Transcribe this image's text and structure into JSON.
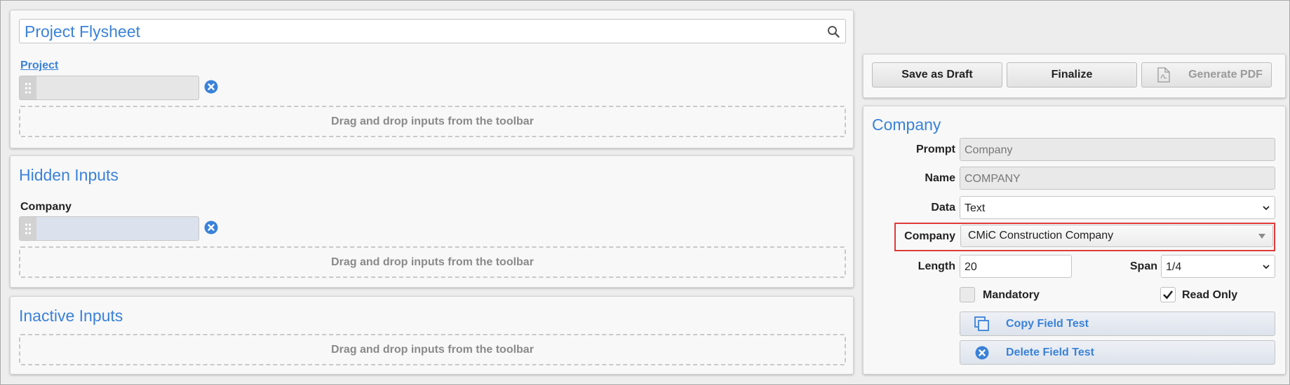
{
  "form": {
    "title": "Project Flysheet",
    "project_label": "Project",
    "dropzone_hint": "Drag and drop inputs from the toolbar"
  },
  "hidden_inputs": {
    "heading": "Hidden Inputs",
    "company_label": "Company",
    "dropzone_hint": "Drag and drop inputs from the toolbar"
  },
  "inactive_inputs": {
    "heading": "Inactive Inputs",
    "dropzone_hint": "Drag and drop inputs from the toolbar"
  },
  "toolbar": {
    "save_draft_label": "Save as Draft",
    "finalize_label": "Finalize",
    "generate_pdf_label": "Generate PDF"
  },
  "properties": {
    "heading": "Company",
    "prompt_label": "Prompt",
    "prompt_value": "Company",
    "name_label": "Name",
    "name_value": "COMPANY",
    "data_label": "Data",
    "data_value": "Text",
    "company_label": "Company",
    "company_value": "CMiC Construction Company",
    "length_label": "Length",
    "length_value": "20",
    "span_label": "Span",
    "span_value": "1/4",
    "mandatory_label": "Mandatory",
    "mandatory_checked": false,
    "read_only_label": "Read Only",
    "read_only_checked": true,
    "copy_label": "Copy Field Test",
    "delete_label": "Delete Field Test"
  },
  "colors": {
    "accent": "#3a82d9",
    "highlight": "#e03a3a"
  }
}
